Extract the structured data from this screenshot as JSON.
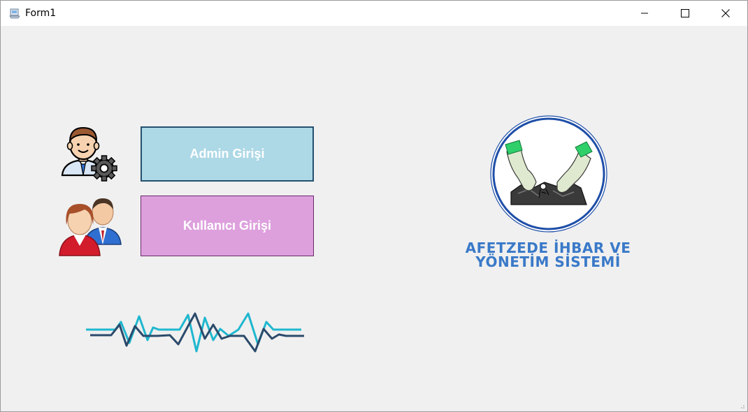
{
  "window": {
    "title": "Form1"
  },
  "buttons": {
    "admin_label": "Admin Girişi",
    "user_label": "Kullanıcı Girişi"
  },
  "logo": {
    "line1": "AFETZEDE İHBAR VE",
    "line2": "YÖNETİM SİSTEMİ"
  },
  "icons": [
    "app-icon",
    "minimize-icon",
    "maximize-icon",
    "close-icon",
    "admin-user-gear-icon",
    "users-couple-icon",
    "heartbeat-wave-icon",
    "disaster-logo-icon"
  ],
  "colors": {
    "admin_button_bg": "#add8e6",
    "admin_button_border": "#24506e",
    "user_button_bg": "#dda0dd",
    "logo_text": "#3a79c8",
    "wave_dark": "#2b4a6b",
    "wave_cyan": "#1fb7cf"
  }
}
